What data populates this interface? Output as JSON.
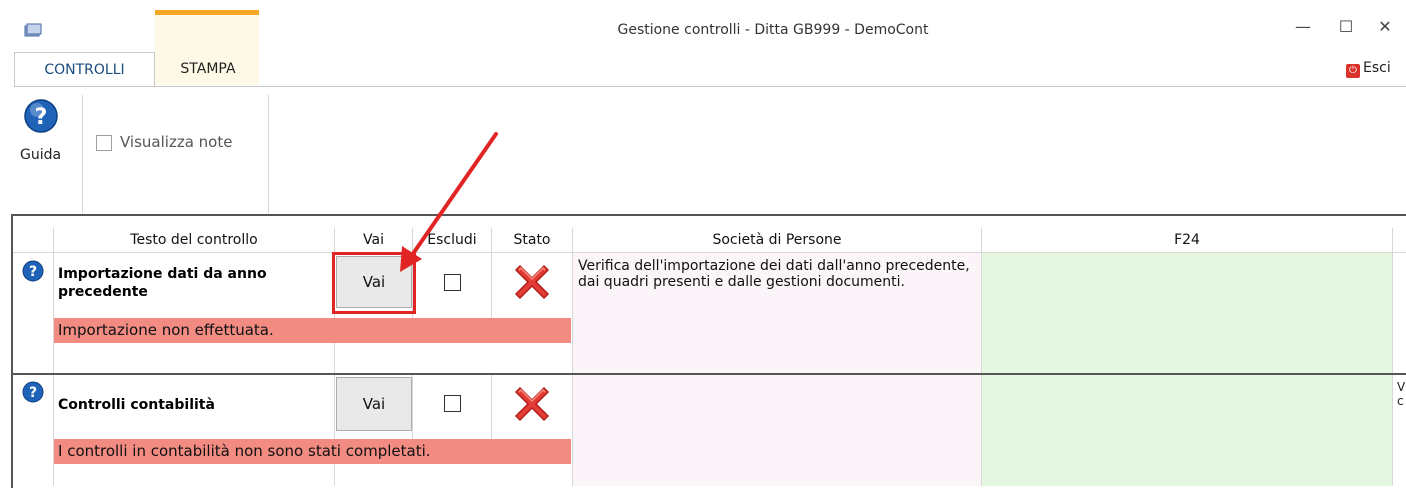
{
  "window": {
    "title": "Gestione controlli - Ditta GB999 - DemoCont",
    "minimize_glyph": "—",
    "maximize_glyph": "☐",
    "close_glyph": "✕"
  },
  "ribbon": {
    "tabs": [
      {
        "label": "CONTROLLI",
        "active": true
      },
      {
        "label": "STAMPA",
        "active": false
      }
    ],
    "exit_label": "Esci",
    "guida_label": "Guida",
    "visualizza_note_label": "Visualizza note",
    "visualizza_note_checked": false
  },
  "grid": {
    "columns": [
      "Testo del controllo",
      "Vai",
      "Escludi",
      "Stato",
      "Società di Persone",
      "F24"
    ],
    "rows": [
      {
        "title": "Importazione dati da anno precedente",
        "title_line1": "Importazione dati da anno",
        "title_line2": "precedente",
        "vai_label": "Vai",
        "excluded": false,
        "status_icon": "red-x-icon",
        "message": "Importazione non effettuata.",
        "societa_text": "Verifica dell'importazione dei dati dall'anno precedente, dai quadri presenti e dalle gestioni documenti.",
        "highlighted": true
      },
      {
        "title": "Controlli contabilità",
        "vai_label": "Vai",
        "excluded": false,
        "status_icon": "red-x-icon",
        "message": "I controlli in contabilità non sono stati completati.",
        "societa_text": "",
        "truncated_right": "V\nc"
      }
    ]
  },
  "colors": {
    "accent_orange": "#f5a623",
    "message_red": "#f28b82",
    "highlight_red": "#e12525",
    "f24_green": "#e5f6e1",
    "societa_pink": "#fbf5f9",
    "help_blue": "#1e63b8"
  }
}
